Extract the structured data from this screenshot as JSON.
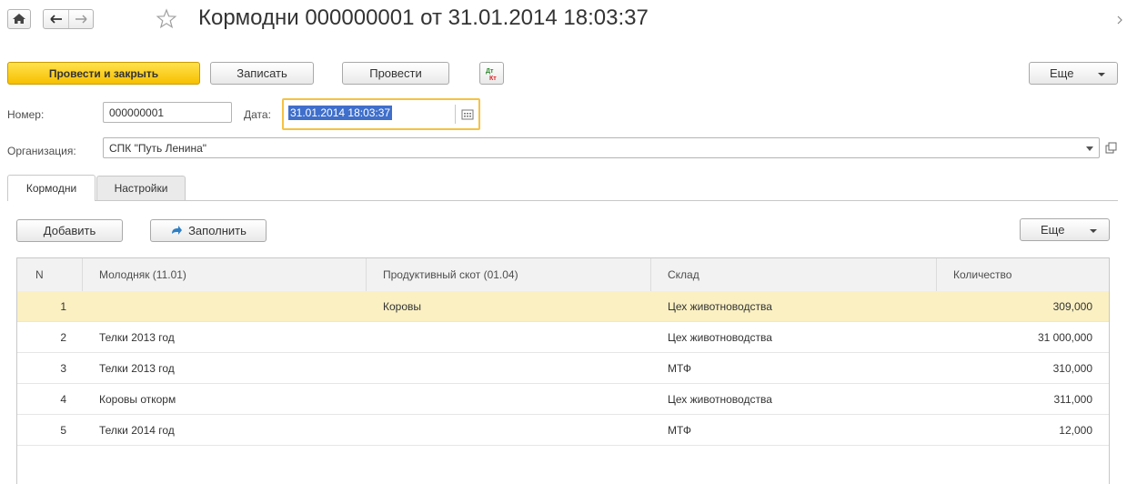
{
  "window": {
    "title": "Кормодни 000000001 от 31.01.2014 18:03:37"
  },
  "toolbar": {
    "post_close_label": "Провести и закрыть",
    "save_label": "Записать",
    "post_label": "Провести",
    "dtkt_icon_text": "Дт Кт",
    "more_label": "Еще"
  },
  "form": {
    "number_label": "Номер:",
    "number_value": "000000001",
    "date_label": "Дата:",
    "date_value": "31.01.2014 18:03:37",
    "org_label": "Организация:",
    "org_value": "СПК \"Путь Ленина\""
  },
  "tabs": [
    {
      "label": "Кормодни",
      "active": true
    },
    {
      "label": "Настройки",
      "active": false
    }
  ],
  "table_toolbar": {
    "add_label": "Добавить",
    "fill_label": "Заполнить",
    "more_label": "Еще"
  },
  "table": {
    "columns": [
      "N",
      "Молодняк (11.01)",
      "Продуктивный скот (01.04)",
      "Склад",
      "Количество"
    ],
    "rows": [
      {
        "n": "1",
        "young": "",
        "productive": "Коровы",
        "warehouse": "Цех животноводства",
        "qty": "309,000",
        "selected": true
      },
      {
        "n": "2",
        "young": "Телки 2013 год",
        "productive": "",
        "warehouse": "Цех животноводства",
        "qty": "31 000,000",
        "selected": false
      },
      {
        "n": "3",
        "young": "Телки 2013 год",
        "productive": "",
        "warehouse": "МТФ",
        "qty": "310,000",
        "selected": false
      },
      {
        "n": "4",
        "young": "Коровы откорм",
        "productive": "",
        "warehouse": "Цех животноводства",
        "qty": "311,000",
        "selected": false
      },
      {
        "n": "5",
        "young": "Телки 2014 год",
        "productive": "",
        "warehouse": "МТФ",
        "qty": "12,000",
        "selected": false
      }
    ]
  },
  "colors": {
    "primary_button": "#f6c000",
    "date_focus_border": "#f5c242",
    "selected_row": "#fbf0c2",
    "date_selection": "#3f6fcb"
  }
}
